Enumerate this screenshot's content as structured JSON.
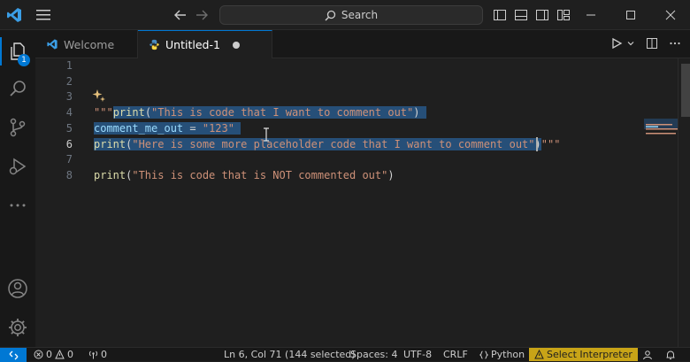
{
  "titlebar": {
    "search_label": "Search",
    "icons": [
      "vscode-logo-icon",
      "menu-icon",
      "back-arrow-icon",
      "forward-arrow-icon",
      "search-icon",
      "toggle-sidebar-icon",
      "toggle-panel-icon",
      "toggle-secondary-sidebar-icon",
      "customize-layout-icon",
      "minimize-icon",
      "maximize-icon",
      "close-icon"
    ]
  },
  "activitybar": {
    "explorer_badge": "1",
    "icons": [
      "explorer-icon",
      "search-icon",
      "source-control-icon",
      "run-debug-icon",
      "more-icon",
      "accounts-icon",
      "manage-gear-icon"
    ]
  },
  "tabs": {
    "welcome_label": "Welcome",
    "untitled_label": "Untitled-1"
  },
  "editor": {
    "line_numbers": [
      "1",
      "2",
      "3",
      "4",
      "5",
      "6",
      "7",
      "8"
    ],
    "active_line": 6,
    "lines": {
      "l4_prefix": "\"\"\"",
      "l4_fn": "print",
      "l4_open": "(",
      "l4_str": "\"This is code that I want to comment out\"",
      "l4_close": ")",
      "l5_var": "comment_me_out",
      "l5_op": " = ",
      "l5_str": "\"123\"",
      "l6_fn": "print",
      "l6_open": "(",
      "l6_str": "\"Here is some more placeholder code that I want to comment out\"",
      "l6_close": ")",
      "l6_suffix": "\"\"\"",
      "l8_fn": "print",
      "l8_open": "(",
      "l8_str": "\"This is code that is NOT commented out\"",
      "l8_close": ")"
    }
  },
  "statusbar": {
    "errors": "0",
    "warnings": "0",
    "ports": "0",
    "cursor_position": "Ln 6, Col 71 (144 selected)",
    "indentation": "Spaces: 4",
    "encoding": "UTF-8",
    "line_ending": "CRLF",
    "language": "Python",
    "interpreter": "Select Interpreter"
  },
  "colors": {
    "accent": "#0078d4",
    "selection": "#264f78",
    "warning_bg": "#c8a417",
    "string": "#ce9178",
    "function": "#dcdcaa",
    "variable": "#9cdcfe"
  }
}
